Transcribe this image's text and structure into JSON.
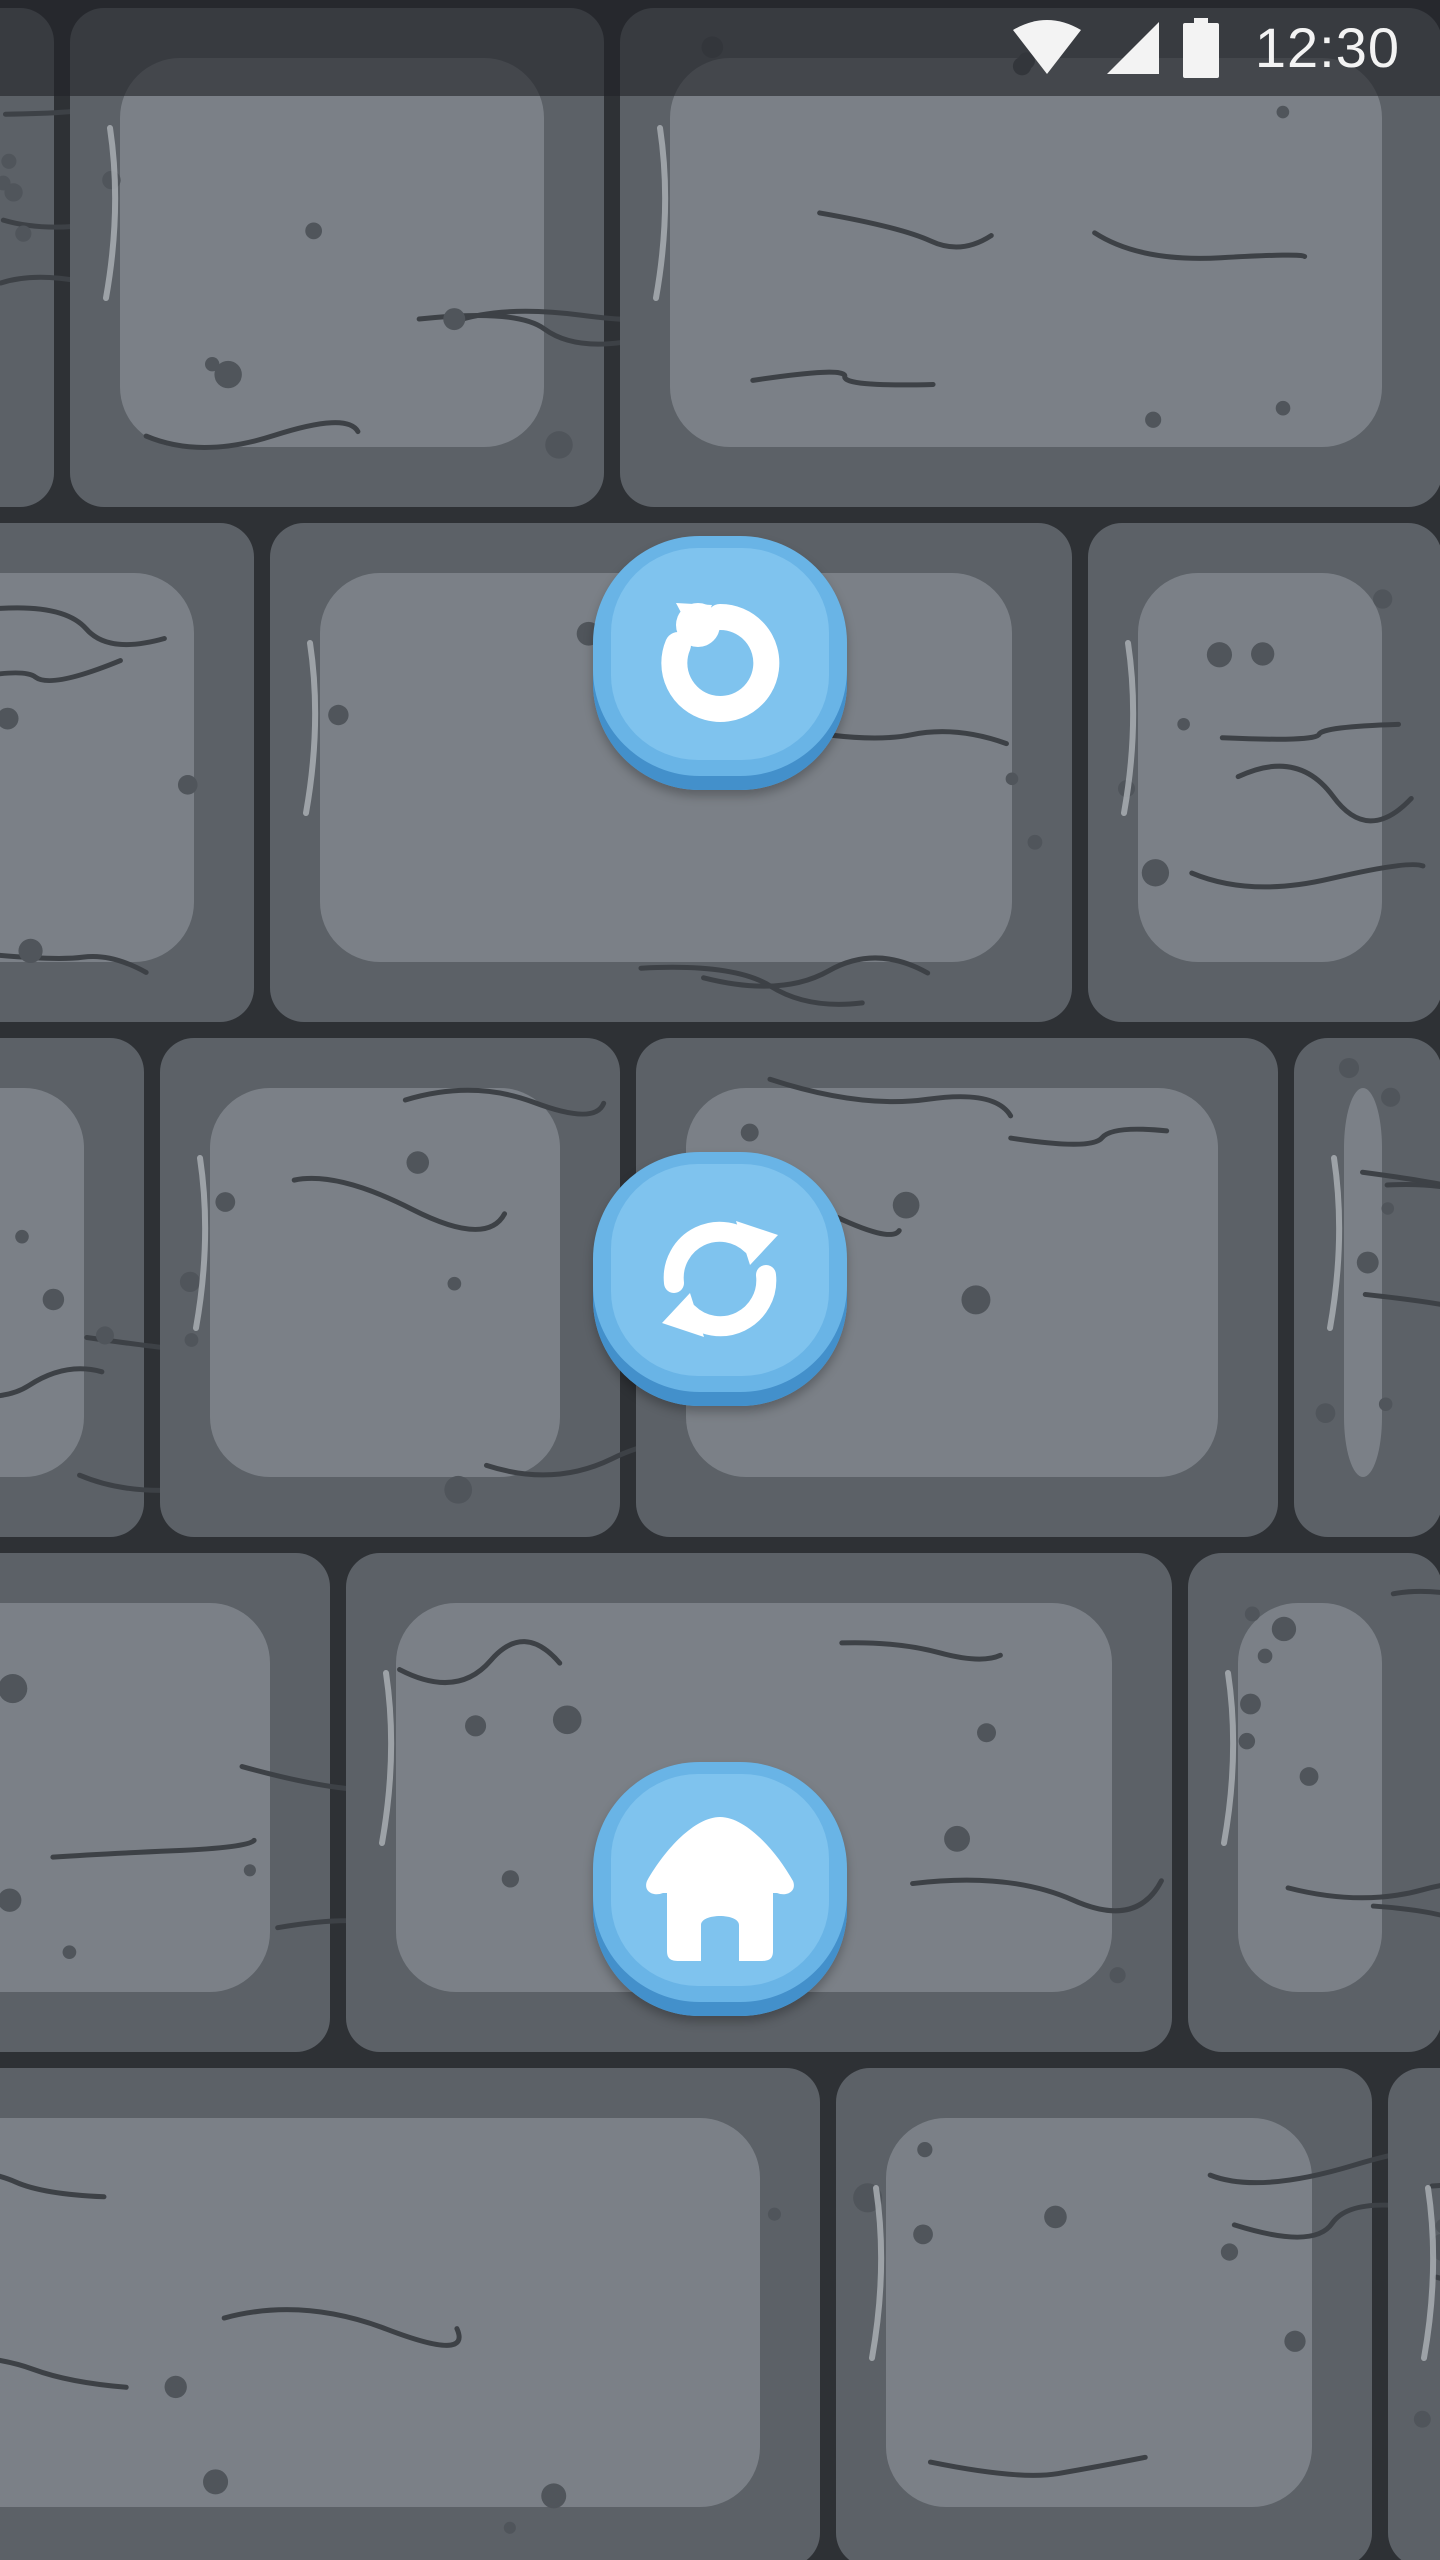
{
  "status_bar": {
    "time": "12:30",
    "icons": [
      "wifi-icon",
      "cellular-signal-icon",
      "battery-icon"
    ]
  },
  "buttons": [
    {
      "name": "restart-button",
      "icon": "restart-icon"
    },
    {
      "name": "replay-button",
      "icon": "refresh-icon"
    },
    {
      "name": "home-button",
      "icon": "home-icon"
    }
  ],
  "colors": {
    "button_blue": "#69b4e6",
    "button_highlight": "#7fc3ee",
    "stone_light": "#7b8087",
    "stone_dark": "#5c6167",
    "mortar": "#2e3135"
  }
}
